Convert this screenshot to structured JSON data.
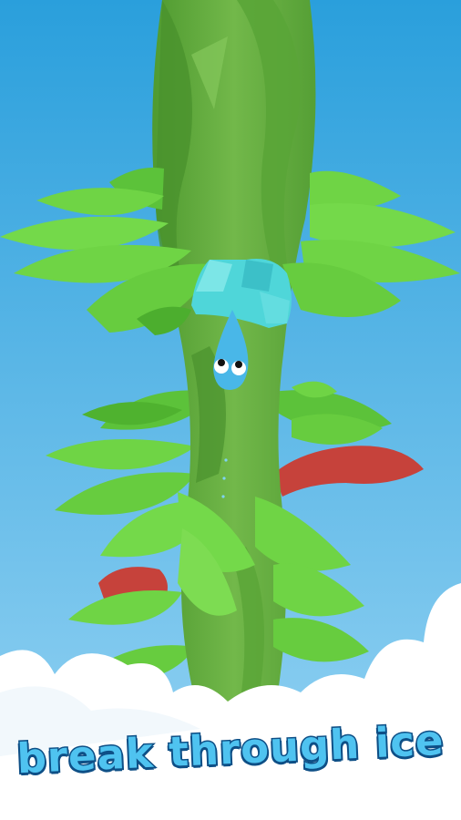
{
  "game": {
    "caption": "break through ice"
  },
  "colors": {
    "sky_top": "#2a9fdc",
    "sky_bottom": "#8fd0f2",
    "stalk": "#5fa83c",
    "leaf": "#6fd445",
    "leaf_shadow": "#4cae2e",
    "ice": "#4fd6d9",
    "character": "#49b7e8",
    "hazard": "#c6423b",
    "cloud": "#ffffff",
    "caption_fill": "#4fc3f0",
    "caption_outline": "#0e4f86"
  },
  "icons": {
    "character": "blue-drop-character-icon",
    "ice": "ice-block-icon",
    "hazard": "red-branch-hazard-icon"
  }
}
